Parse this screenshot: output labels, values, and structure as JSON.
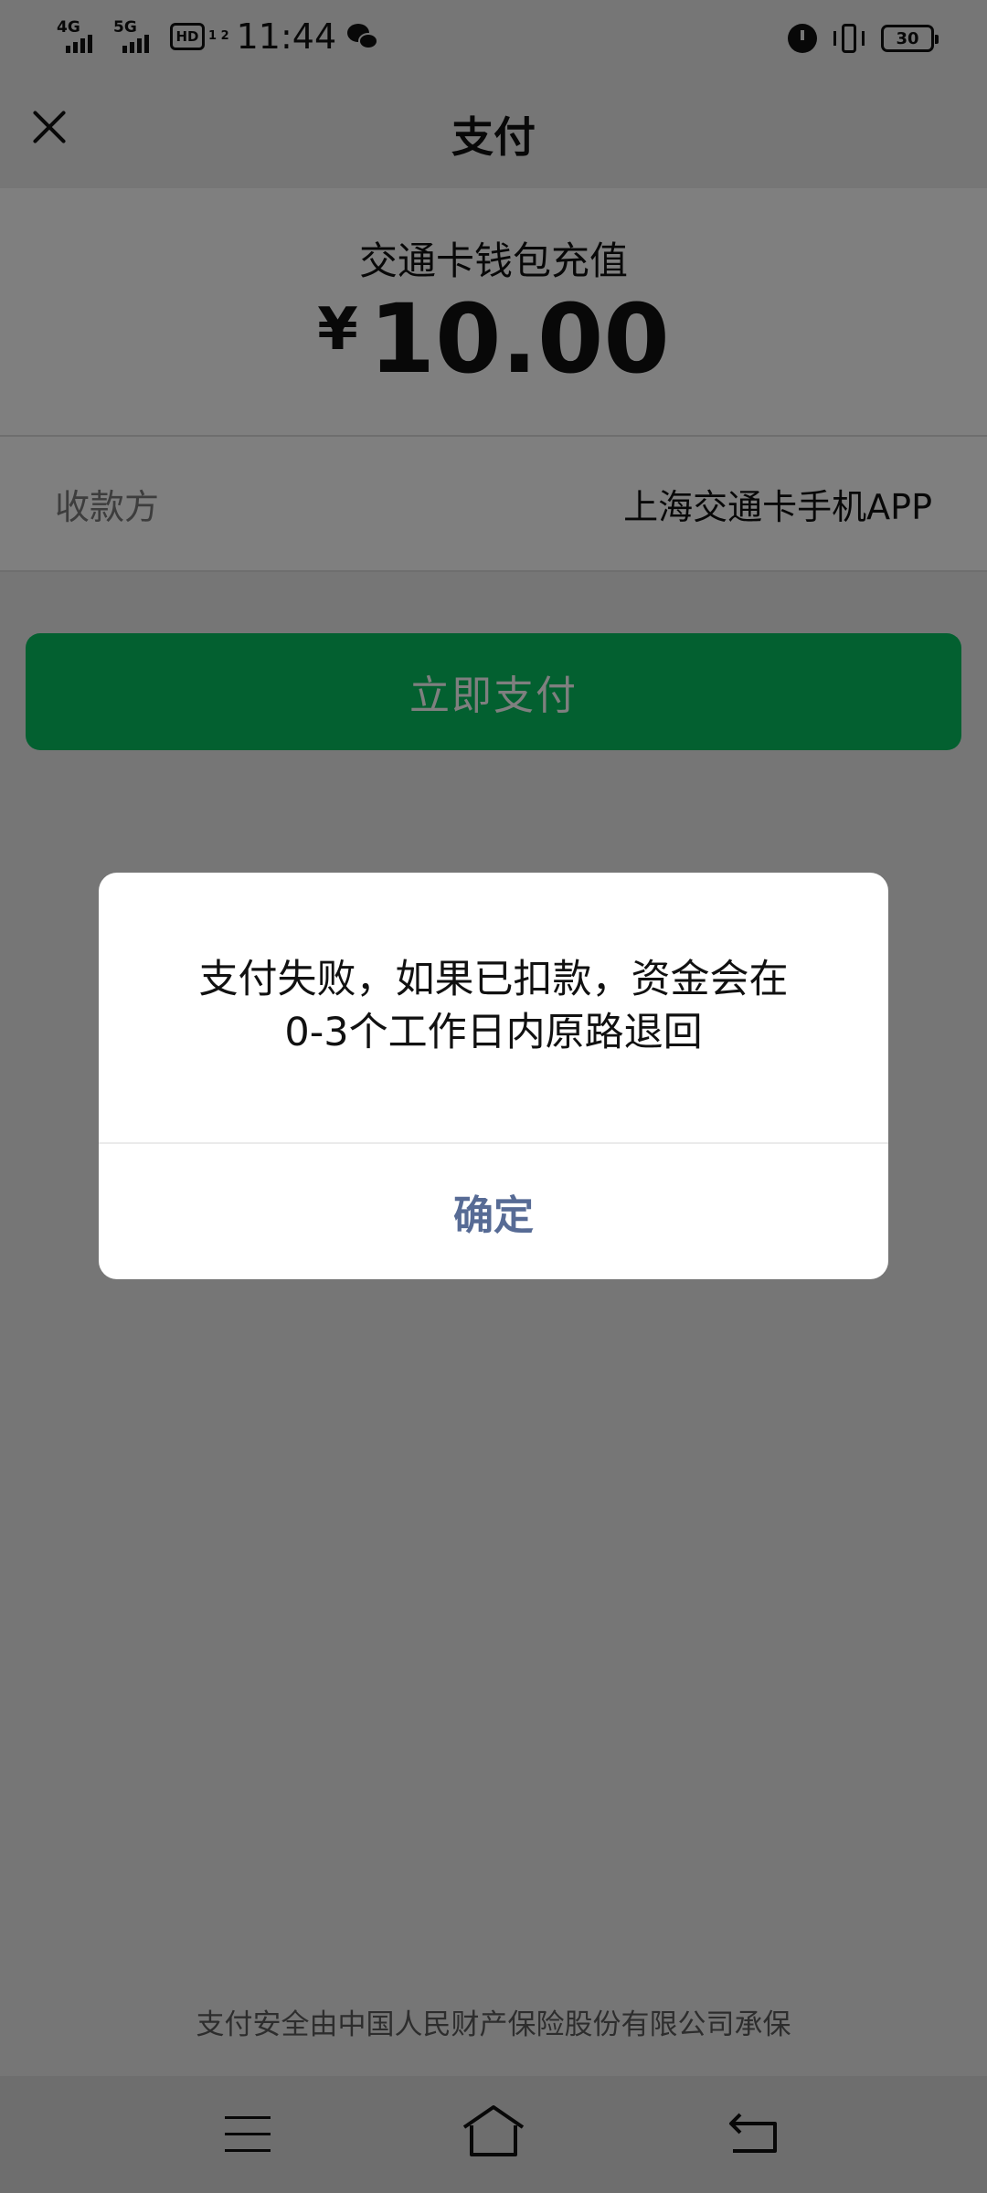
{
  "status_bar": {
    "sim1_tag": "4G",
    "sim2_tag": "5G",
    "hd_label": "HD",
    "hd_sub": "1 2",
    "time": "11:44",
    "battery": "30"
  },
  "header": {
    "title": "支付"
  },
  "payment": {
    "merchant_title": "交通卡钱包充值",
    "currency_symbol": "¥",
    "amount": "10.00"
  },
  "payee": {
    "label": "收款方",
    "value": "上海交通卡手机APP"
  },
  "pay_button": {
    "label": "立即支付"
  },
  "dialog": {
    "message_line1": "支付失败，如果已扣款，资金会在",
    "message_line2": "0-3个工作日内原路退回",
    "confirm_label": "确定"
  },
  "footer": {
    "note": "支付安全由中国人民财产保险股份有限公司承保"
  },
  "colors": {
    "accent_green": "#07c160",
    "link_blue": "#576b95"
  }
}
